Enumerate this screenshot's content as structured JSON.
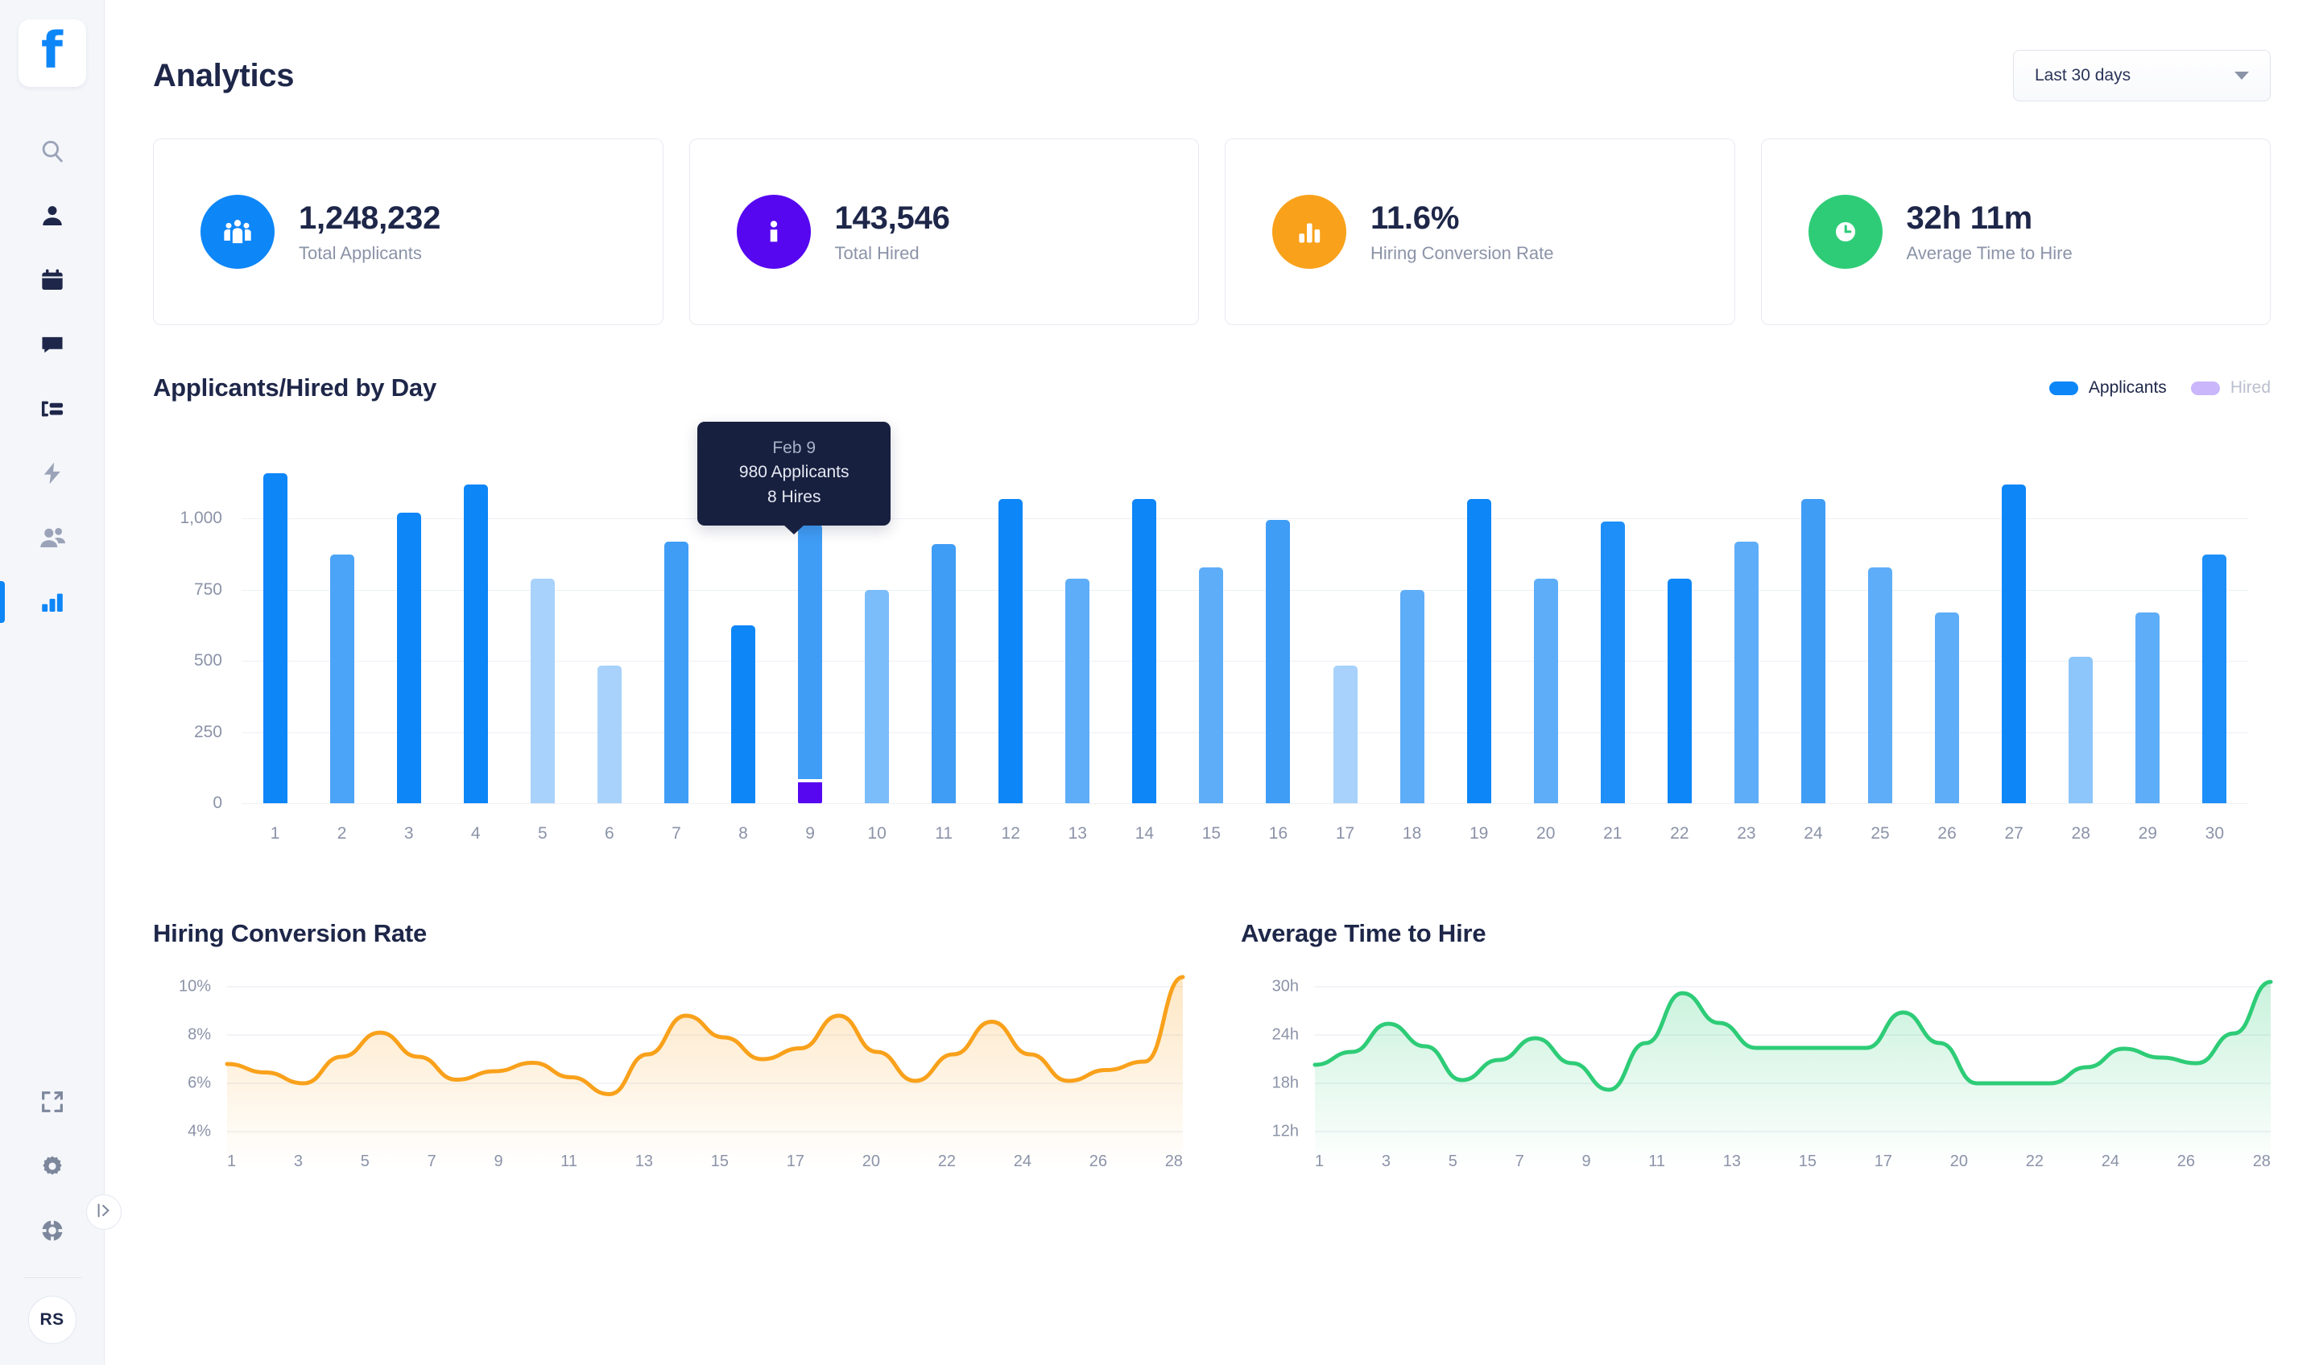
{
  "sidebar": {
    "logo_glyph": "f",
    "nav_items": [
      {
        "name": "search",
        "icon": "search-icon",
        "active": false
      },
      {
        "name": "candidates",
        "icon": "person-icon",
        "active": false
      },
      {
        "name": "calendar",
        "icon": "calendar-icon",
        "active": false
      },
      {
        "name": "messages",
        "icon": "chat-icon",
        "active": false
      },
      {
        "name": "pipeline",
        "icon": "list-icon",
        "active": false
      },
      {
        "name": "automations",
        "icon": "lightning-icon",
        "active": false
      },
      {
        "name": "team",
        "icon": "people-icon",
        "active": false
      },
      {
        "name": "analytics",
        "icon": "bar-chart-icon",
        "active": true
      }
    ],
    "bottom_items": [
      {
        "name": "fullscreen",
        "icon": "expand-icon"
      },
      {
        "name": "settings",
        "icon": "gear-icon"
      },
      {
        "name": "support",
        "icon": "lifebuoy-icon"
      }
    ],
    "collapse_icon": "panel-expand-icon",
    "avatar_initials": "RS"
  },
  "header": {
    "title": "Analytics",
    "date_range": "Last 30 days",
    "date_range_icon": "chevron-down-icon"
  },
  "kpis": [
    {
      "value": "1,248,232",
      "label": "Total Applicants",
      "icon": "group-icon",
      "color": "#0d86f8"
    },
    {
      "value": "143,546",
      "label": "Total Hired",
      "icon": "person-icon",
      "color": "#5607f0"
    },
    {
      "value": "11.6%",
      "label": "Hiring Conversion Rate",
      "icon": "bar-chart-icon",
      "color": "#f9a11b"
    },
    {
      "value": "32h 11m",
      "label": "Average Time to Hire",
      "icon": "clock-icon",
      "color": "#2ecc77"
    }
  ],
  "bar_section": {
    "title": "Applicants/Hired by Day",
    "legend": [
      {
        "label": "Applicants",
        "color": "#0d86f8",
        "text_color": "#1e2749"
      },
      {
        "label": "Hired",
        "color": "#c9b6fb",
        "text_color": "#b9bfcd"
      }
    ],
    "tooltip": {
      "date": "Feb 9",
      "applicants": "980 Applicants",
      "hires": "8 Hires"
    }
  },
  "conversion_section": {
    "title": "Hiring Conversion Rate"
  },
  "time_section": {
    "title": "Average Time to Hire"
  },
  "chart_data": [
    {
      "type": "bar",
      "title": "Applicants/Hired by Day",
      "xlabel": "",
      "ylabel": "",
      "ylim": [
        0,
        1250
      ],
      "yticks": [
        "0",
        "250",
        "500",
        "750",
        "1,000"
      ],
      "ytick_values": [
        0,
        250,
        500,
        750,
        1000
      ],
      "grid": true,
      "legend": [
        "Applicants",
        "Hired"
      ],
      "legend_position": "top-right",
      "categories": [
        "1",
        "2",
        "3",
        "4",
        "5",
        "6",
        "7",
        "8",
        "9",
        "10",
        "11",
        "12",
        "13",
        "14",
        "15",
        "16",
        "17",
        "18",
        "19",
        "20",
        "21",
        "22",
        "23",
        "24",
        "25",
        "26",
        "27",
        "28",
        "29",
        "30"
      ],
      "series": [
        {
          "name": "Applicants",
          "values": [
            1160,
            875,
            1020,
            1120,
            790,
            485,
            920,
            625,
            980,
            750,
            910,
            1070,
            790,
            1070,
            830,
            995,
            485,
            750,
            1070,
            790,
            990,
            790,
            920,
            1070,
            830,
            670,
            1120,
            515,
            670,
            875
          ]
        },
        {
          "name": "Hired",
          "values": [
            0,
            0,
            0,
            0,
            0,
            0,
            0,
            0,
            8,
            0,
            0,
            0,
            0,
            0,
            0,
            0,
            0,
            0,
            0,
            0,
            0,
            0,
            0,
            0,
            0,
            0,
            0,
            0,
            0,
            0
          ]
        }
      ],
      "bar_shades": [
        "#0d86f8",
        "#4ba4f7",
        "#0d86f8",
        "#0d86f8",
        "#a8d2fb",
        "#a8d2fb",
        "#3f9df6",
        "#0d86f8",
        "#3f9df6",
        "#7bbcfa",
        "#3f9df6",
        "#0d86f8",
        "#5dadf8",
        "#0d86f8",
        "#5dadf8",
        "#3f9df6",
        "#a8d2fb",
        "#5dadf8",
        "#0d86f8",
        "#5dadf8",
        "#1e8ff8",
        "#0d86f8",
        "#5dadf8",
        "#3f9df6",
        "#5dadf8",
        "#5dadf8",
        "#0d86f8",
        "#8cc6fa",
        "#5dadf8",
        "#1e8ff8"
      ],
      "highlight": {
        "index": 8,
        "label": "Feb 9",
        "applicants": 980,
        "hires": 8
      }
    },
    {
      "type": "area",
      "title": "Hiring Conversion Rate",
      "xlabel": "",
      "ylabel": "",
      "ylim": [
        4,
        10
      ],
      "yticks": [
        "4%",
        "6%",
        "8%",
        "10%"
      ],
      "ytick_values": [
        4,
        6,
        8,
        10
      ],
      "xticks": [
        "1",
        "3",
        "5",
        "7",
        "9",
        "11",
        "13",
        "15",
        "17",
        "20",
        "22",
        "24",
        "26",
        "28"
      ],
      "grid": true,
      "line_color": "#f9a11b",
      "x": [
        0,
        1,
        2,
        3,
        4,
        5,
        6,
        7,
        8,
        9,
        10,
        11,
        12,
        13,
        14,
        15,
        16,
        17,
        18,
        19,
        20,
        21,
        22,
        23
      ],
      "values": [
        6.8,
        6.45,
        6.0,
        7.1,
        8.1,
        7.1,
        6.15,
        6.5,
        6.85,
        6.25,
        5.55,
        7.2,
        8.8,
        7.9,
        7.0,
        7.45,
        8.8,
        7.3,
        6.1,
        7.2,
        8.55,
        7.2,
        6.1,
        6.55,
        6.9,
        10.4
      ]
    },
    {
      "type": "area",
      "title": "Average Time to Hire",
      "xlabel": "",
      "ylabel": "",
      "ylim": [
        12,
        30
      ],
      "yticks": [
        "12h",
        "18h",
        "24h",
        "30h"
      ],
      "ytick_values": [
        12,
        18,
        24,
        30
      ],
      "xticks": [
        "1",
        "3",
        "5",
        "7",
        "9",
        "11",
        "13",
        "15",
        "17",
        "20",
        "22",
        "24",
        "26",
        "28"
      ],
      "grid": true,
      "line_color": "#2ecc77",
      "values": [
        20.3,
        21.9,
        25.4,
        22.6,
        18.4,
        20.9,
        23.6,
        20.5,
        17.2,
        23.0,
        29.2,
        25.5,
        22.4,
        22.4,
        22.4,
        22.4,
        26.8,
        23.0,
        18.0,
        18.0,
        18.0,
        20.0,
        22.3,
        21.2,
        20.5,
        24.2,
        30.6
      ]
    }
  ]
}
